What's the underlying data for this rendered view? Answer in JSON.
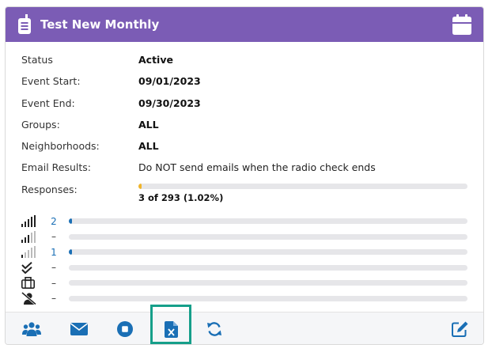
{
  "header": {
    "title": "Test New Monthly",
    "radio_icon": "handheld-radio-icon",
    "calendar_icon": "calendar-icon",
    "background": "#7b5cb5"
  },
  "details": [
    {
      "key": "status",
      "label": "Status",
      "value": "Active",
      "bold": true
    },
    {
      "key": "event_start",
      "label": "Event Start:",
      "value": "09/01/2023",
      "bold": true
    },
    {
      "key": "event_end",
      "label": "Event End:",
      "value": "09/30/2023",
      "bold": true
    },
    {
      "key": "groups",
      "label": "Groups:",
      "value": "ALL",
      "bold": true
    },
    {
      "key": "neighborhoods",
      "label": "Neighborhoods:",
      "value": "ALL",
      "bold": true
    },
    {
      "key": "email_results",
      "label": "Email Results:",
      "value": "Do NOT send emails when the radio check ends",
      "bold": false
    }
  ],
  "responses": {
    "label": "Responses:",
    "caption": "3 of 293  (1.02%)",
    "fraction": 0.0102,
    "color": "#f0b429"
  },
  "stats": [
    {
      "icon": "signal-strong-icon",
      "count": "2",
      "fraction": 0.0068,
      "count_color": "blue"
    },
    {
      "icon": "signal-medium-icon",
      "count": "–",
      "fraction": 0,
      "count_color": "gray"
    },
    {
      "icon": "signal-weak-icon",
      "count": "1",
      "fraction": 0.0034,
      "count_color": "blue"
    },
    {
      "icon": "double-check-icon",
      "count": "–",
      "fraction": 0,
      "count_color": "gray"
    },
    {
      "icon": "briefcase-icon",
      "count": "–",
      "fraction": 0,
      "count_color": "gray"
    },
    {
      "icon": "user-slash-icon",
      "count": "–",
      "fraction": 0,
      "count_color": "gray"
    }
  ],
  "footer": {
    "buttons": [
      "users-icon",
      "envelope-icon",
      "stop-circle-icon",
      "excel-file-icon",
      "refresh-icon",
      "edit-icon"
    ],
    "accent": "#1a6fb5",
    "highlight_color": "#169f8a"
  }
}
